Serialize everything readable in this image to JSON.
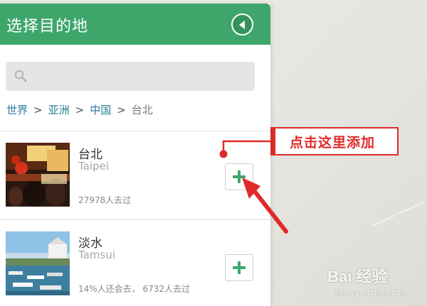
{
  "header": {
    "title": "选择目的地",
    "back_icon": "back-arrow-icon"
  },
  "search": {
    "placeholder": "",
    "icon": "search-icon"
  },
  "breadcrumb": {
    "items": [
      "世界",
      "亚洲",
      "中国"
    ],
    "separator": ">",
    "current": "台北"
  },
  "destinations": [
    {
      "name_cn": "台北",
      "name_en": "Taipei",
      "stats": "27978人去过",
      "add_icon": "plus-icon"
    },
    {
      "name_cn": "淡水",
      "name_en": "Tamsui",
      "stats": "14%人还会去， 6732人去过",
      "add_icon": "plus-icon"
    }
  ],
  "annotation": {
    "text": "点击这里添加",
    "color": "#e02a2a"
  },
  "watermark": {
    "brand": "Bai 经验",
    "url": "jingyan.baidu.com"
  },
  "colors": {
    "accent_green": "#3ea66b",
    "link_blue": "#2a7a9a",
    "annotation_red": "#e02a2a"
  }
}
